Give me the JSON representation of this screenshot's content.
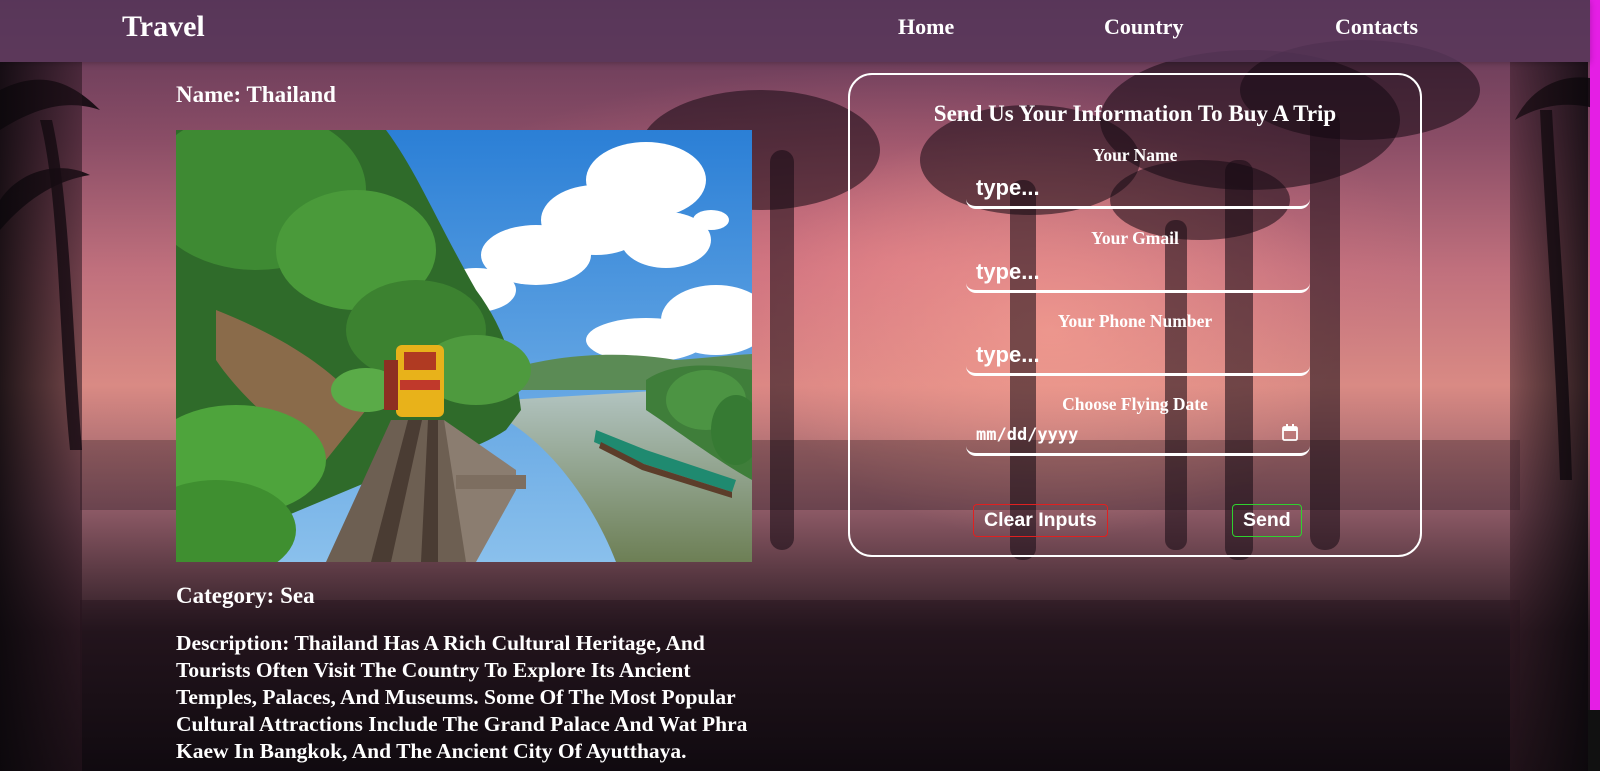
{
  "header": {
    "brand": "Travel",
    "nav": [
      "Home",
      "Country",
      "Contacts"
    ]
  },
  "country": {
    "name": "Name: Thailand",
    "photo_icon": "train-river-photo",
    "category": "Category: Sea",
    "description": "Description: Thailand Has A Rich Cultural Heritage, And Tourists Often Visit The Country To Explore Its Ancient Temples, Palaces, And Museums. Some Of The Most Popular Cultural Attractions Include The Grand Palace And Wat Phra Kaew In Bangkok, And The Ancient City Of Ayutthaya."
  },
  "form": {
    "title": "Send Us Your Information To Buy A Trip",
    "name_label": "Your Name",
    "name_placeholder": "type...",
    "gmail_label": "Your Gmail",
    "gmail_placeholder": "type...",
    "phone_label": "Your Phone Number",
    "phone_placeholder": "type...",
    "date_label": "Choose Flying Date",
    "date_placeholder": "mm/dd/yyyy",
    "date_icon": "calendar-icon",
    "clear_button": "Clear Inputs",
    "send_button": "Send"
  },
  "colors": {
    "navbar": "#58375a",
    "accent_edge": "#e51ee5",
    "clear_border": "#e02020",
    "send_border": "#2fd12f",
    "text": "#ffffff"
  }
}
